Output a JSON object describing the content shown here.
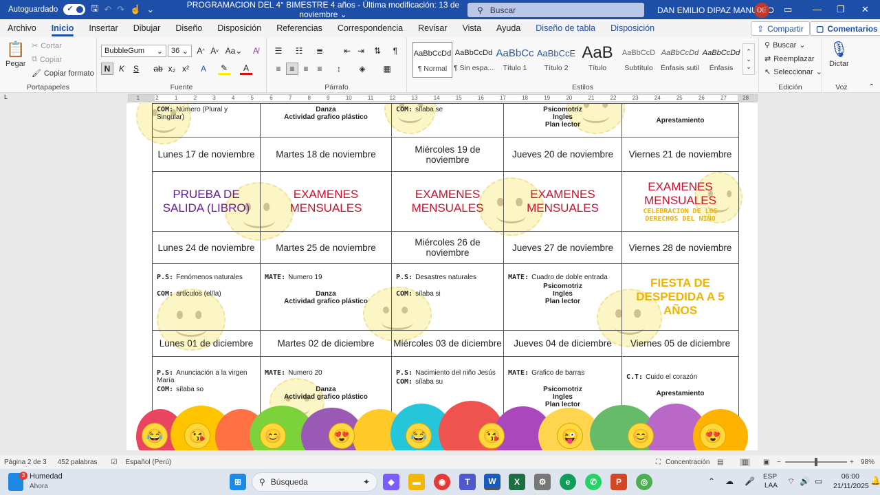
{
  "titlebar": {
    "autosave_label": "Autoguardado",
    "doc_title": "PROGRAMACION DEL 4° BIMESTRE 4 años  -  Última modificación: 13 de noviembre",
    "search_placeholder": "Buscar",
    "user_name": "DAN EMILIO DIPAZ MANUELO",
    "user_initials": "DE"
  },
  "menu": {
    "tabs": [
      "Archivo",
      "Inicio",
      "Insertar",
      "Dibujar",
      "Diseño",
      "Disposición",
      "Referencias",
      "Correspondencia",
      "Revisar",
      "Vista",
      "Ayuda",
      "Diseño de tabla",
      "Disposición"
    ],
    "active_tab": "Inicio",
    "share_label": "Compartir",
    "comments_label": "Comentarios"
  },
  "ribbon": {
    "clipboard": {
      "paste": "Pegar",
      "cut": "Cortar",
      "copy": "Copiar",
      "format_painter": "Copiar formato",
      "group": "Portapapeles"
    },
    "font": {
      "name": "BubbleGum",
      "size": "36",
      "bold": "N",
      "italic": "K",
      "underline": "S",
      "strike": "ab",
      "sub": "x₂",
      "sup": "x²",
      "group": "Fuente"
    },
    "paragraph": {
      "group": "Párrafo"
    },
    "styles": {
      "group": "Estilos",
      "items": [
        {
          "sample": "AaBbCcDd",
          "name": "¶ Normal"
        },
        {
          "sample": "AaBbCcDd",
          "name": "¶ Sin espa..."
        },
        {
          "sample": "AaBbCc",
          "name": "Título 1"
        },
        {
          "sample": "AaBbCcE",
          "name": "Título 2"
        },
        {
          "sample": "AaB",
          "name": "Título"
        },
        {
          "sample": "AaBbCcD",
          "name": "Subtítulo"
        },
        {
          "sample": "AaBbCcDd",
          "name": "Énfasis sutil"
        },
        {
          "sample": "AaBbCcDd",
          "name": "Énfasis"
        }
      ]
    },
    "editing": {
      "find": "Buscar",
      "replace": "Reemplazar",
      "select": "Seleccionar",
      "group": "Edición"
    },
    "voice": {
      "dictate": "Dictar",
      "group": "Voz"
    }
  },
  "ruler": {
    "marks": [
      "1",
      "2",
      "1",
      "2",
      "3",
      "4",
      "5",
      "6",
      "7",
      "8",
      "9",
      "10",
      "11",
      "12",
      "13",
      "14",
      "15",
      "16",
      "17",
      "18",
      "19",
      "20",
      "21",
      "22",
      "23",
      "24",
      "25",
      "26",
      "27",
      "28"
    ]
  },
  "schedule": {
    "row0": {
      "c1": {
        "lbl": "COM:",
        "val": "Número (Plural y Singular)"
      },
      "c2": {
        "l1": "Danza",
        "l2": "Actividad grafico plástico"
      },
      "c3": {
        "lbl": "COM:",
        "val": "sílaba se"
      },
      "c4": {
        "l1": "Psicomotriz",
        "l2": "Ingles",
        "l3": "Plan lector"
      },
      "c5": {
        "l1": "Aprestamiento"
      }
    },
    "dates1": [
      "Lunes 17 de noviembre",
      "Martes 18 de noviembre",
      "Miércoles 19 de noviembre",
      "Jueves 20 de noviembre",
      "Viernes 21 de noviembre"
    ],
    "row1": {
      "c1": "PRUEBA DE SALIDA (LIBRO)",
      "c2": "EXAMENES MENSUALES",
      "c3": "EXAMENES MENSUALES",
      "c4": "EXAMENES MENSUALES",
      "c5": "EXAMENES MENSUALES",
      "c5_note": "CELEBRACION DE LOS DERECHOS DEL NIÑO"
    },
    "dates2": [
      "Lunes 24 de noviembre",
      "Martes 25 de noviembre",
      "Miércoles 26 de noviembre",
      "Jueves 27 de noviembre",
      "Viernes 28 de noviembre"
    ],
    "row2": {
      "c1": {
        "lbl1": "P.S:",
        "val1": "Fenómenos naturales",
        "lbl2": "COM:",
        "val2": "artículos (el/la)"
      },
      "c2": {
        "lbl1": "MATE:",
        "val1": "Numero 19",
        "l1": "Danza",
        "l2": "Actividad grafico plástico"
      },
      "c3": {
        "lbl1": "P.S:",
        "val1": "Desastres naturales",
        "lbl2": "COM:",
        "val2": "sílaba si"
      },
      "c4": {
        "lbl1": "MATE:",
        "val1": "Cuadro de doble entrada",
        "l1": "Psicomotriz",
        "l2": "Ingles",
        "l3": "Plan lector"
      },
      "c5": "FIESTA DE DESPEDIDA A 5 AÑOS"
    },
    "dates3": [
      "Lunes 01 de diciembre",
      "Martes 02 de diciembre",
      "Miércoles 03 de diciembre",
      "Jueves 04 de diciembre",
      "Viernes 05 de diciembre"
    ],
    "row3": {
      "c1": {
        "lbl1": "P.S:",
        "val1": "Anunciación a la virgen María",
        "lbl2": "COM:",
        "val2": "sílaba so"
      },
      "c2": {
        "lbl1": "MATE:",
        "val1": "Numero 20",
        "l1": "Danza",
        "l2": "Actividad grafico plástico"
      },
      "c3": {
        "lbl1": "P.S:",
        "val1": "Nacimiento del niño Jesús",
        "lbl2": "COM:",
        "val2": "sílaba su"
      },
      "c4": {
        "lbl1": "MATE:",
        "val1": "Grafico de barras",
        "l1": "Psicomotriz",
        "l2": "Ingles",
        "l3": "Plan lector"
      },
      "c5": {
        "lbl1": "C.T:",
        "val1": "Cuido el corazón",
        "l1": "Aprestamiento"
      }
    }
  },
  "status": {
    "page": "Página 2 de 3",
    "words": "452 palabras",
    "language": "Español (Perú)",
    "focus": "Concentración",
    "zoom": "98%"
  },
  "taskbar": {
    "weather_title": "Humedad",
    "weather_sub": "Ahora",
    "weather_badge": "3",
    "search": "Búsqueda",
    "lang1": "ESP",
    "lang2": "LAA",
    "time": "06:00",
    "date": "21/11/2025"
  },
  "colors": {
    "word_blue": "#1e4fa8",
    "exam_red": "#d0102f",
    "purple": "#6a1b9a",
    "yellow": "#f0b400"
  }
}
